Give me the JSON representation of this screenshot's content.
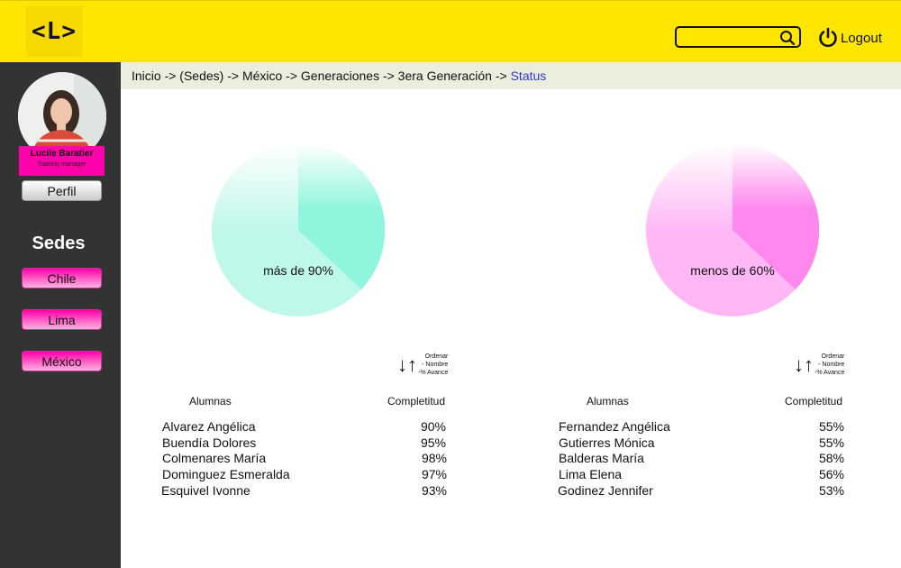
{
  "header": {
    "logo_text": "<L>",
    "search_placeholder": "",
    "logout_label": "Logout"
  },
  "sidebar": {
    "user_name": "Lucile Baratier",
    "user_role": "Training manager",
    "profile_label": "Perfil",
    "sedes_title": "Sedes",
    "sedes": [
      "Chile",
      "Lima",
      "México"
    ]
  },
  "breadcrumb": {
    "trail": "Inicio -> (Sedes) -> México -> Generaciones -> 3era Generación -> ",
    "current": "Status"
  },
  "colors": {
    "topbar": "#ffe600",
    "sidebar": "#333333",
    "accent_pink": "#ff00aa",
    "pie_green": "#8ff5dc",
    "pie_pink": "#ff88ef"
  },
  "left_group": {
    "pie_label": "más de 90%",
    "sort": {
      "title": "Ordenar",
      "opt1": "- Nombre",
      "opt2": "-% Avance"
    },
    "col_name": "Alumnas",
    "col_value": "Completitud",
    "rows": [
      {
        "name": "Alvarez Angélica",
        "value": "90%"
      },
      {
        "name": "Buendía Dolores",
        "value": "95%"
      },
      {
        "name": "Colmenares María",
        "value": "98%"
      },
      {
        "name": "Dominguez Esmeralda",
        "value": "97%"
      },
      {
        "name": "Esquivel Ivonne",
        "value": "93%"
      }
    ]
  },
  "right_group": {
    "pie_label": "menos de 60%",
    "sort": {
      "title": "Ordenar",
      "opt1": "- Nombre",
      "opt2": "-% Avance"
    },
    "col_name": "Alumnas",
    "col_value": "Completitud",
    "rows": [
      {
        "name": "Fernandez Angélica",
        "value": "55%"
      },
      {
        "name": "Gutierres Mónica",
        "value": "55%"
      },
      {
        "name": "Balderas María",
        "value": "58%"
      },
      {
        "name": "Lima Elena",
        "value": "56%"
      },
      {
        "name": "Godinez Jennifer",
        "value": "53%"
      }
    ]
  }
}
